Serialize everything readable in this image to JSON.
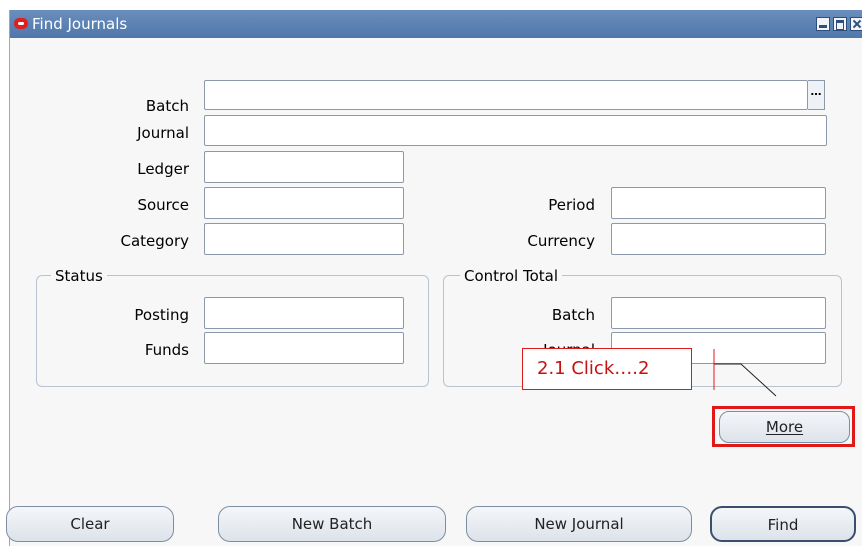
{
  "window": {
    "title": "Find Journals"
  },
  "fields": {
    "batch": {
      "label": "Batch",
      "value": ""
    },
    "journal": {
      "label": "Journal",
      "value": ""
    },
    "ledger": {
      "label": "Ledger",
      "value": ""
    },
    "source": {
      "label": "Source",
      "value": ""
    },
    "period": {
      "label": "Period",
      "value": ""
    },
    "category": {
      "label": "Category",
      "value": ""
    },
    "currency": {
      "label": "Currency",
      "value": ""
    },
    "lov_glyph": "…"
  },
  "status": {
    "title": "Status",
    "posting": {
      "label": "Posting",
      "value": ""
    },
    "funds": {
      "label": "Funds",
      "value": ""
    }
  },
  "control_total": {
    "title": "Control Total",
    "batch": {
      "label": "Batch",
      "value": ""
    },
    "journal": {
      "label": "Journal",
      "value": ""
    }
  },
  "buttons": {
    "more": "More",
    "clear": "Clear",
    "new_batch": "New Batch",
    "new_journal": "New Journal",
    "find": "Find"
  },
  "annotation": {
    "text": "2.1 Click….2",
    "color": "#e01818"
  },
  "colors": {
    "titlebar": "#5a81b3",
    "background": "#f7f7f7",
    "highlight": "#e01818"
  }
}
